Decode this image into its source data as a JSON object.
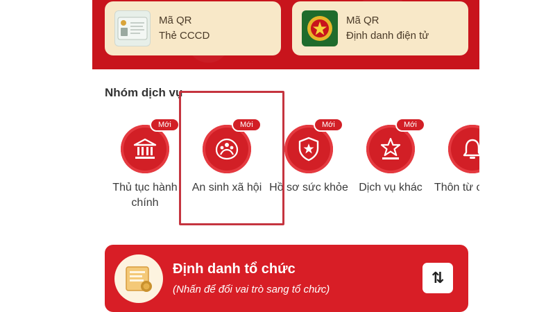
{
  "qr_cards": [
    {
      "line1": "Mã QR",
      "line2": "Thẻ CCCD",
      "icon": "id-card-icon"
    },
    {
      "line1": "Mã QR",
      "line2": "Định danh điện tử",
      "icon": "police-emblem-icon"
    }
  ],
  "services_section": {
    "title": "Nhóm dịch vụ",
    "badge": "Mới",
    "items": [
      {
        "label": "Thủ tục hành chính",
        "icon": "building-icon",
        "badge": "Mới"
      },
      {
        "label": "An sinh xã hội",
        "icon": "family-icon",
        "badge": "Mới"
      },
      {
        "label": "Hồ sơ sức khỏe",
        "icon": "health-shield-icon",
        "badge": "Mới"
      },
      {
        "label": "Dịch vụ khác",
        "icon": "star-podium-icon",
        "badge": "Mới"
      },
      {
        "label": "Thôn từ cơ nhà",
        "icon": "bell-icon",
        "badge": ""
      }
    ]
  },
  "org_banner": {
    "title": "Định danh tổ chức",
    "subtitle": "(Nhấn để đổi vai trò sang tổ chức)",
    "switch_glyph": "⇅"
  },
  "colors": {
    "primary_red": "#d21f26",
    "card_cream": "#f8e8c8",
    "highlight_border": "#c5343f"
  }
}
